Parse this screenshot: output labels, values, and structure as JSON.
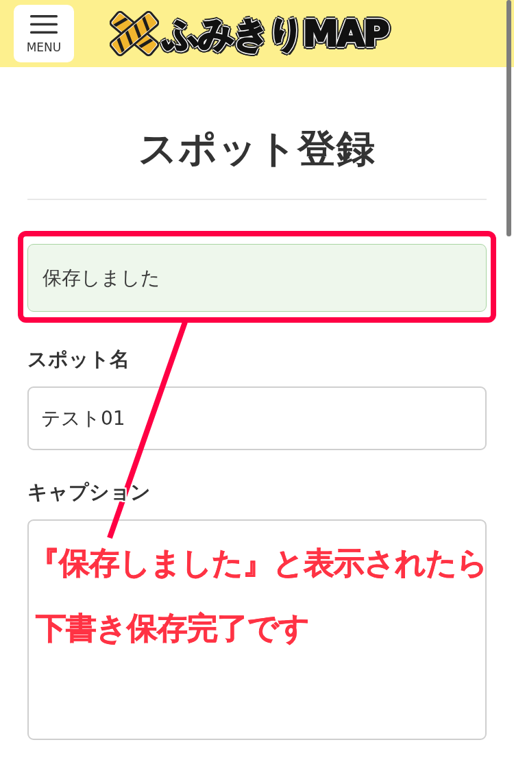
{
  "header": {
    "menu_button": {
      "label": "MENU"
    },
    "logo": {
      "text": "ふみきりMAP"
    }
  },
  "page_title": "スポット登録",
  "alert": {
    "message": "保存しました",
    "highlighted": true
  },
  "form": {
    "fields": [
      {
        "kind": "input",
        "label": "スポット名",
        "value": "テスト01"
      },
      {
        "kind": "textarea",
        "label": "キャプション"
      }
    ]
  },
  "annotation": {
    "lines": [
      "『保存しました』と表示されたら",
      "下書き保存完了です"
    ]
  }
}
